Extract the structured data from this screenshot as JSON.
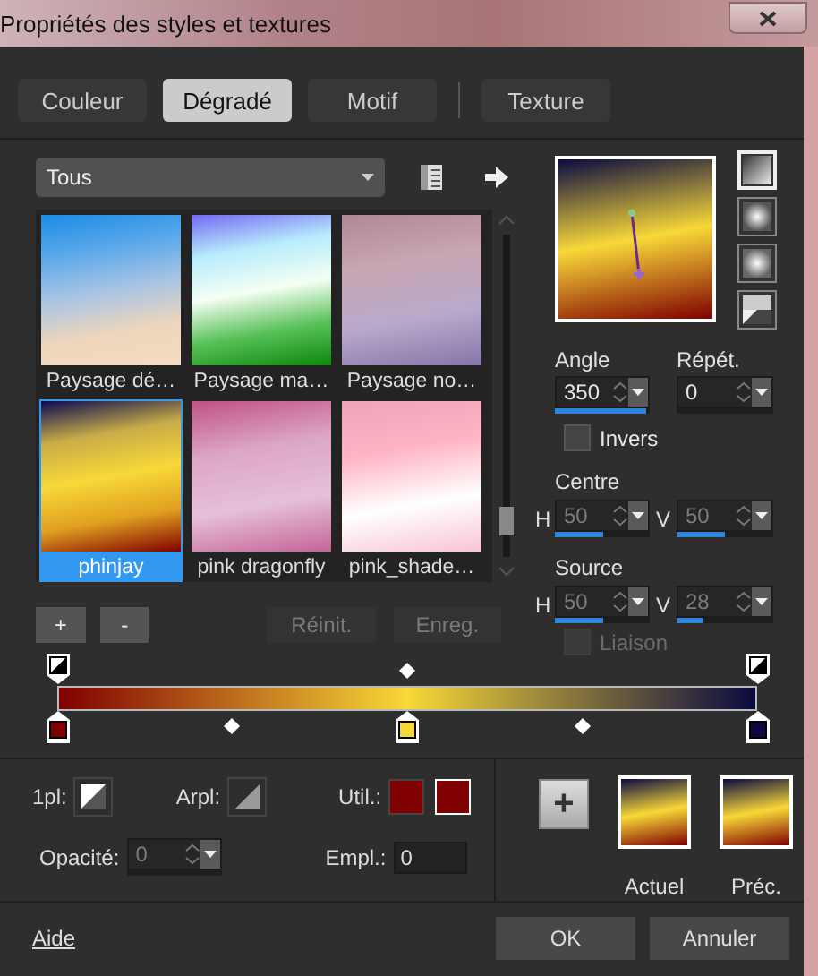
{
  "window": {
    "title": "Propriétés des styles et textures"
  },
  "tabs": [
    {
      "label": "Couleur",
      "selected": false
    },
    {
      "label": "Dégradé",
      "selected": true
    },
    {
      "label": "Motif",
      "selected": false
    },
    {
      "label": "Texture",
      "selected": false
    }
  ],
  "category": {
    "value": "Tous"
  },
  "gradients": [
    {
      "label": "Paysage dé…",
      "selected": false
    },
    {
      "label": "Paysage ma…",
      "selected": false
    },
    {
      "label": "Paysage no…",
      "selected": false
    },
    {
      "label": "phinjay",
      "selected": true
    },
    {
      "label": "pink dragonfly",
      "selected": false
    },
    {
      "label": "pink_shade…",
      "selected": false
    }
  ],
  "list_buttons": [
    {
      "label": "+",
      "disabled": false
    },
    {
      "label": "-",
      "disabled": false
    },
    {
      "label": "Réinit.",
      "disabled": true
    },
    {
      "label": "Enreg.",
      "disabled": true
    }
  ],
  "styles": [
    {
      "kind": "linear",
      "selected": true
    },
    {
      "kind": "rectangular",
      "selected": false
    },
    {
      "kind": "sunburst",
      "selected": false
    },
    {
      "kind": "radial",
      "selected": false
    }
  ],
  "angle": {
    "label": "Angle",
    "value": "350",
    "level": 0.97,
    "disabled": false
  },
  "repeat": {
    "label": "Répét.",
    "value": "0",
    "disabled": false
  },
  "invert": {
    "label": "Invers",
    "checked": false,
    "disabled": false
  },
  "centre": {
    "label": "Centre",
    "h": {
      "axis": "H",
      "value": "50",
      "level": 0.5,
      "disabled": true
    },
    "v": {
      "axis": "V",
      "value": "50",
      "level": 0.5,
      "disabled": true
    }
  },
  "source": {
    "label": "Source",
    "h": {
      "axis": "H",
      "value": "50",
      "level": 0.5,
      "disabled": true
    },
    "v": {
      "axis": "V",
      "value": "28",
      "level": 0.28,
      "disabled": true
    }
  },
  "link": {
    "label": "Liaison",
    "checked": false,
    "disabled": true
  },
  "editor": {
    "color_stops": [
      {
        "color": "#800000"
      },
      {
        "color": "#f8d838"
      },
      {
        "color": "#0a0a40"
      }
    ]
  },
  "options": {
    "fill_label": "1pl:",
    "fill_mode_label": "Arpl:",
    "use_label": "Util.:",
    "use_colors": [
      {
        "color": "#800000"
      },
      {
        "color": "#800000"
      }
    ],
    "opacity": {
      "label": "Opacité:",
      "value": "0",
      "disabled": true
    },
    "location": {
      "label": "Empl.:",
      "value": "0"
    }
  },
  "add_button": {
    "label": "+"
  },
  "current": {
    "label": "Actuel"
  },
  "previous": {
    "label": "Préc."
  },
  "footer": {
    "help": "Aide",
    "buttons": [
      "OK",
      "Annuler"
    ]
  }
}
